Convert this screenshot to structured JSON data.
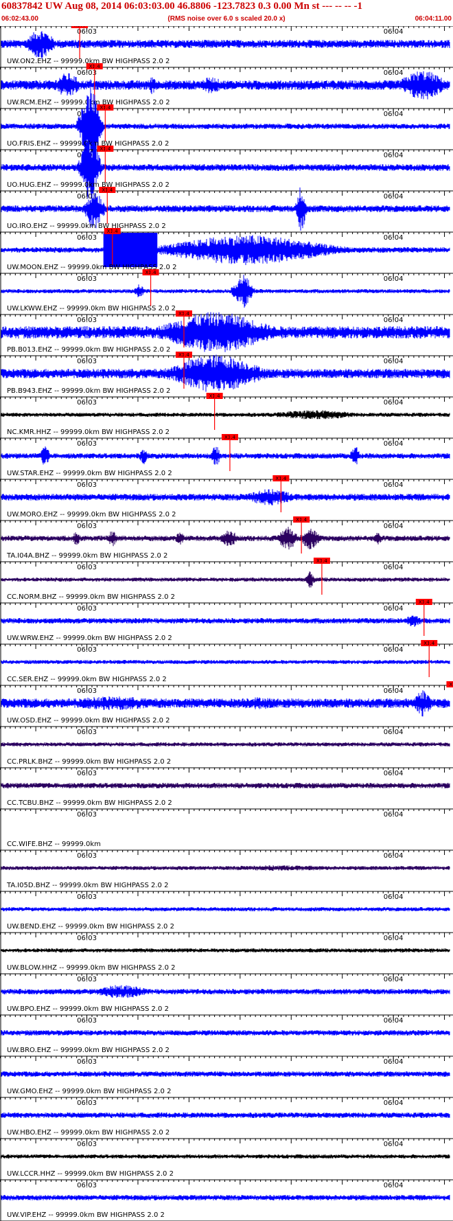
{
  "header": {
    "title": "60837842 UW Aug 08, 2014 06:03:03.00   46.8806 -123.7823  0.3 0.00 Mn st --- -- --   -1",
    "start_time": "06:02:43.00",
    "rms_note": "(RMS noise over 6.0 s scaled 20.0 x)",
    "end_time": "06:04:11.00"
  },
  "colors": {
    "accent": "#cc0000",
    "blue": "#0000ff",
    "purple": "#2b0060",
    "black": "#000000",
    "pick": "#ff0000"
  },
  "chart_data": {
    "type": "line",
    "time_range": [
      "06:02:43.00",
      "06:04:11.00"
    ],
    "tick_labels": [
      "06:03",
      "06:04"
    ],
    "pick_label": "X1.4",
    "series": [
      {
        "name": "UW.ON2.EHZ -- 99999.0km BW  HIGHPASS  2.0  2",
        "color": "blue",
        "pick_time": "06:02:58.6",
        "noise": 6,
        "bursts": [
          [
            0.09,
            0.03,
            22
          ]
        ]
      },
      {
        "name": "UW.RCM.EHZ -- 99999.0km BW  HIGHPASS  2.0  2",
        "color": "blue",
        "pick_time": "06:03:01.5",
        "noise": 7,
        "bursts": [
          [
            0.15,
            0.03,
            18
          ],
          [
            0.34,
            0.01,
            14
          ],
          [
            0.47,
            0.03,
            12
          ],
          [
            0.94,
            0.05,
            22
          ]
        ]
      },
      {
        "name": "UO.FRIS.EHZ -- 99999.0km BW  HIGHPASS  2.0  2",
        "color": "blue",
        "pick_time": "06:03:03.6",
        "noise": 4,
        "bursts": [
          [
            0.2,
            0.02,
            70
          ]
        ]
      },
      {
        "name": "UO.HUG.EHZ -- 99999.0km BW  HIGHPASS  2.0  2",
        "color": "blue",
        "pick_time": "06:03:03.6",
        "noise": 5,
        "bursts": [
          [
            0.2,
            0.02,
            50
          ]
        ]
      },
      {
        "name": "UO.IRO.EHZ -- 99999.0km BW  HIGHPASS  2.0  2",
        "color": "blue",
        "pick_time": "06:03:04.0",
        "noise": 5,
        "bursts": [
          [
            0.21,
            0.02,
            30
          ],
          [
            0.67,
            0.01,
            35
          ]
        ]
      },
      {
        "name": "UW.MOON.EHZ -- 99999.0km BW  HIGHPASS  2.0  2",
        "color": "blue",
        "pick_time": "06:03:05.0",
        "noise": 4,
        "blocks": [
          [
            0.23,
            0.35
          ]
        ],
        "bursts": [
          [
            0.55,
            0.18,
            22
          ]
        ]
      },
      {
        "name": "UW.LKWW.EHZ -- 99999.0km BW  HIGHPASS  2.0  2",
        "color": "blue",
        "pick_time": "06:03:12.5",
        "noise": 3,
        "bursts": [
          [
            0.31,
            0.01,
            10
          ],
          [
            0.54,
            0.02,
            25
          ]
        ]
      },
      {
        "name": "PB.B013.EHZ -- 99999.0km BW  HIGHPASS  2.0  2",
        "color": "blue",
        "pick_time": "06:03:19.0",
        "noise": 9,
        "bursts": [
          [
            0.48,
            0.12,
            30
          ]
        ]
      },
      {
        "name": "PB.B943.EHZ -- 99999.0km BW  HIGHPASS  2.0  2",
        "color": "blue",
        "pick_time": "06:03:19.0",
        "noise": 7,
        "bursts": [
          [
            0.48,
            0.1,
            28
          ]
        ]
      },
      {
        "name": "NC.KMR.HHZ -- 99999.0km BW  HIGHPASS  2.0  2",
        "color": "black",
        "pick_time": "06:03:25.0",
        "noise": 3,
        "bursts": [
          [
            0.7,
            0.1,
            7
          ]
        ]
      },
      {
        "name": "UW.STAR.EHZ -- 99999.0km BW  HIGHPASS  2.0  2",
        "color": "blue",
        "pick_time": "06:03:28.0",
        "noise": 4,
        "bursts": [
          [
            0.1,
            0.01,
            16
          ],
          [
            0.32,
            0.01,
            12
          ],
          [
            0.48,
            0.01,
            15
          ],
          [
            0.79,
            0.01,
            16
          ]
        ]
      },
      {
        "name": "UW.MORO.EHZ -- 99999.0km BW  HIGHPASS  2.0  2",
        "color": "blue",
        "pick_time": "06:03:38.0",
        "noise": 5,
        "bursts": [
          [
            0.6,
            0.06,
            12
          ]
        ]
      },
      {
        "name": "TA.I04A.BHZ -- 99999.0km BW  HIGHPASS  2.0  2",
        "color": "purple",
        "pick_time": "06:03:42.0",
        "noise": 4,
        "bursts": [
          [
            0.17,
            0.01,
            10
          ],
          [
            0.25,
            0.01,
            12
          ],
          [
            0.4,
            0.01,
            10
          ],
          [
            0.51,
            0.02,
            12
          ],
          [
            0.64,
            0.02,
            18
          ],
          [
            0.69,
            0.02,
            16
          ],
          [
            0.84,
            0.01,
            9
          ]
        ]
      },
      {
        "name": "CC.NORM.BHZ -- 99999.0km BW  HIGHPASS  2.0  2",
        "color": "purple",
        "pick_time": "06:03:46.0",
        "noise": 3,
        "bursts": [
          [
            0.69,
            0.01,
            12
          ]
        ]
      },
      {
        "name": "UW.WRW.EHZ -- 99999.0km BW  HIGHPASS  2.0  2",
        "color": "blue",
        "pick_time": "06:04:06.0",
        "noise": 4,
        "bursts": [
          [
            0.92,
            0.02,
            9
          ]
        ]
      },
      {
        "name": "CC.SER.EHZ -- 99999.0km BW  HIGHPASS  2.0  2",
        "color": "blue",
        "pick_time": "06:04:07.0",
        "noise": 3,
        "bursts": []
      },
      {
        "name": "UW.OSD.EHZ -- 99999.0km BW  HIGHPASS  2.0  2",
        "color": "blue",
        "pick_time": "06:04:12.0",
        "noise": 7,
        "bursts": [
          [
            0.25,
            0.13,
            10
          ],
          [
            0.57,
            0.08,
            9
          ],
          [
            0.94,
            0.02,
            20
          ]
        ]
      },
      {
        "name": "CC.PRLK.BHZ -- 99999.0km BW  HIGHPASS  2.0  2",
        "color": "purple",
        "pick_time": "",
        "noise": 3,
        "bursts": []
      },
      {
        "name": "CC.TCBU.BHZ -- 99999.0km BW  HIGHPASS  2.0  2",
        "color": "purple",
        "pick_time": "",
        "noise": 4,
        "bursts": []
      },
      {
        "name": "CC.WIFE.BHZ -- 99999.0km",
        "color": "blue",
        "pick_time": "",
        "noise": 0,
        "bursts": []
      },
      {
        "name": "TA.I05D.BHZ -- 99999.0km BW  HIGHPASS  2.0  2",
        "color": "purple",
        "pick_time": "",
        "noise": 3,
        "bursts": [
          [
            0.62,
            0.2,
            4
          ]
        ]
      },
      {
        "name": "UW.BEND.EHZ -- 99999.0km BW  HIGHPASS  2.0  2",
        "color": "blue",
        "pick_time": "",
        "noise": 3,
        "bursts": []
      },
      {
        "name": "UW.BLOW.HHZ -- 99999.0km BW  HIGHPASS  2.0  2",
        "color": "black",
        "pick_time": "",
        "noise": 3,
        "bursts": []
      },
      {
        "name": "UW.BPO.EHZ -- 99999.0km BW  HIGHPASS  2.0  2",
        "color": "blue",
        "pick_time": "",
        "noise": 4,
        "bursts": [
          [
            0.27,
            0.06,
            10
          ]
        ]
      },
      {
        "name": "UW.BRO.EHZ -- 99999.0km BW  HIGHPASS  2.0  2",
        "color": "blue",
        "pick_time": "",
        "noise": 4,
        "bursts": []
      },
      {
        "name": "UW.GMO.EHZ -- 99999.0km BW  HIGHPASS  2.0  2",
        "color": "blue",
        "pick_time": "",
        "noise": 4,
        "bursts": []
      },
      {
        "name": "UW.HBO.EHZ -- 99999.0km BW  HIGHPASS  2.0  2",
        "color": "blue",
        "pick_time": "",
        "noise": 4,
        "bursts": []
      },
      {
        "name": "UW.LCCR.HHZ -- 99999.0km BW  HIGHPASS  2.0  2",
        "color": "black",
        "pick_time": "",
        "noise": 3,
        "bursts": []
      },
      {
        "name": "UW.VIP.EHZ -- 99999.0km BW  HIGHPASS  2.0  2",
        "color": "blue",
        "pick_time": "",
        "noise": 4,
        "bursts": []
      }
    ]
  }
}
